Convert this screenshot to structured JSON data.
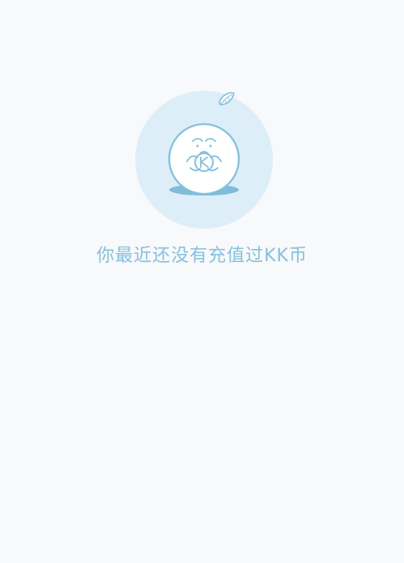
{
  "empty_state": {
    "message": "你最近还没有充值过KK币",
    "illustration_icon": "sad-kk-coin-mascot-icon",
    "colors": {
      "background": "#f7f9fb",
      "circle": "#ddeef8",
      "accent": "#86c0dd",
      "shadow": "#79b8d8"
    }
  }
}
